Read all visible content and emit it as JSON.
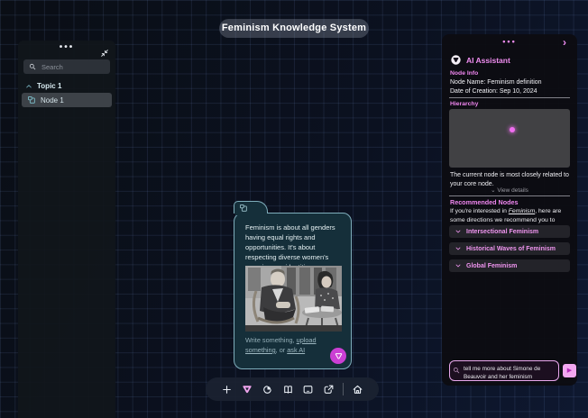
{
  "app": {
    "title": "Feminism Knowledge System"
  },
  "colors": {
    "accent_pink": "#ef8cf0",
    "logo_magenta": "#cb3fd4",
    "card_background": "#152f3a",
    "card_border": "#7faebc",
    "panel_background": "#0c0c12",
    "grid_line": "#23304e"
  },
  "sidebar": {
    "menu_dots": "•••",
    "search_placeholder": "Search",
    "topic_label": "Topic 1",
    "node_label": "Node 1",
    "icons": [
      "more-dots-icon",
      "collapse-icon",
      "search-icon",
      "chevron-up-icon",
      "node-icon"
    ]
  },
  "card": {
    "body": "Feminism is about all genders having equal rights and opportunities. It's about respecting diverse women's experiences, identities, knowledge and strengths.",
    "photo_alt": "black-and-white photo of Jean-Paul Sartre and Simone de Beauvoir at a cafe table",
    "footer_prefix": "Write something, ",
    "footer_upload": "upload something",
    "footer_mid": ", or ",
    "footer_ask": "ask AI",
    "icons": [
      "node-icon",
      "ai-logo-icon"
    ]
  },
  "toolbar": {
    "icons": [
      "plus-icon",
      "ai-logo-icon",
      "sticker-icon",
      "book-icon",
      "screen-icon",
      "share-icon",
      "home-icon"
    ]
  },
  "ai_panel": {
    "menu_dots": "•••",
    "expand_chevron": "›",
    "title": "AI Assistant",
    "node_info": {
      "heading": "Node Info",
      "name": "Node Name: Feminism definition",
      "date": "Date of Creation: Sep 10, 2024"
    },
    "hierarchy": {
      "heading": "Hierarchy",
      "description": "The current node is most closely related to your core node.",
      "view_details": "View details",
      "view_details_chevron": "⌄"
    },
    "recommended": {
      "heading": "Recommended Nodes",
      "intro_prefix": "If you're interested in ",
      "intro_em": "Feminism",
      "intro_suffix": ", here are some directions we recommend you to explore:",
      "items": [
        {
          "label": "Intersectional Feminism"
        },
        {
          "label": "Historical Waves of Feminism"
        },
        {
          "label": "Global Feminism"
        }
      ]
    },
    "chat": {
      "value": "tell me more about Simone de Beauvoir and her feminism",
      "send_glyph": "▶"
    }
  }
}
